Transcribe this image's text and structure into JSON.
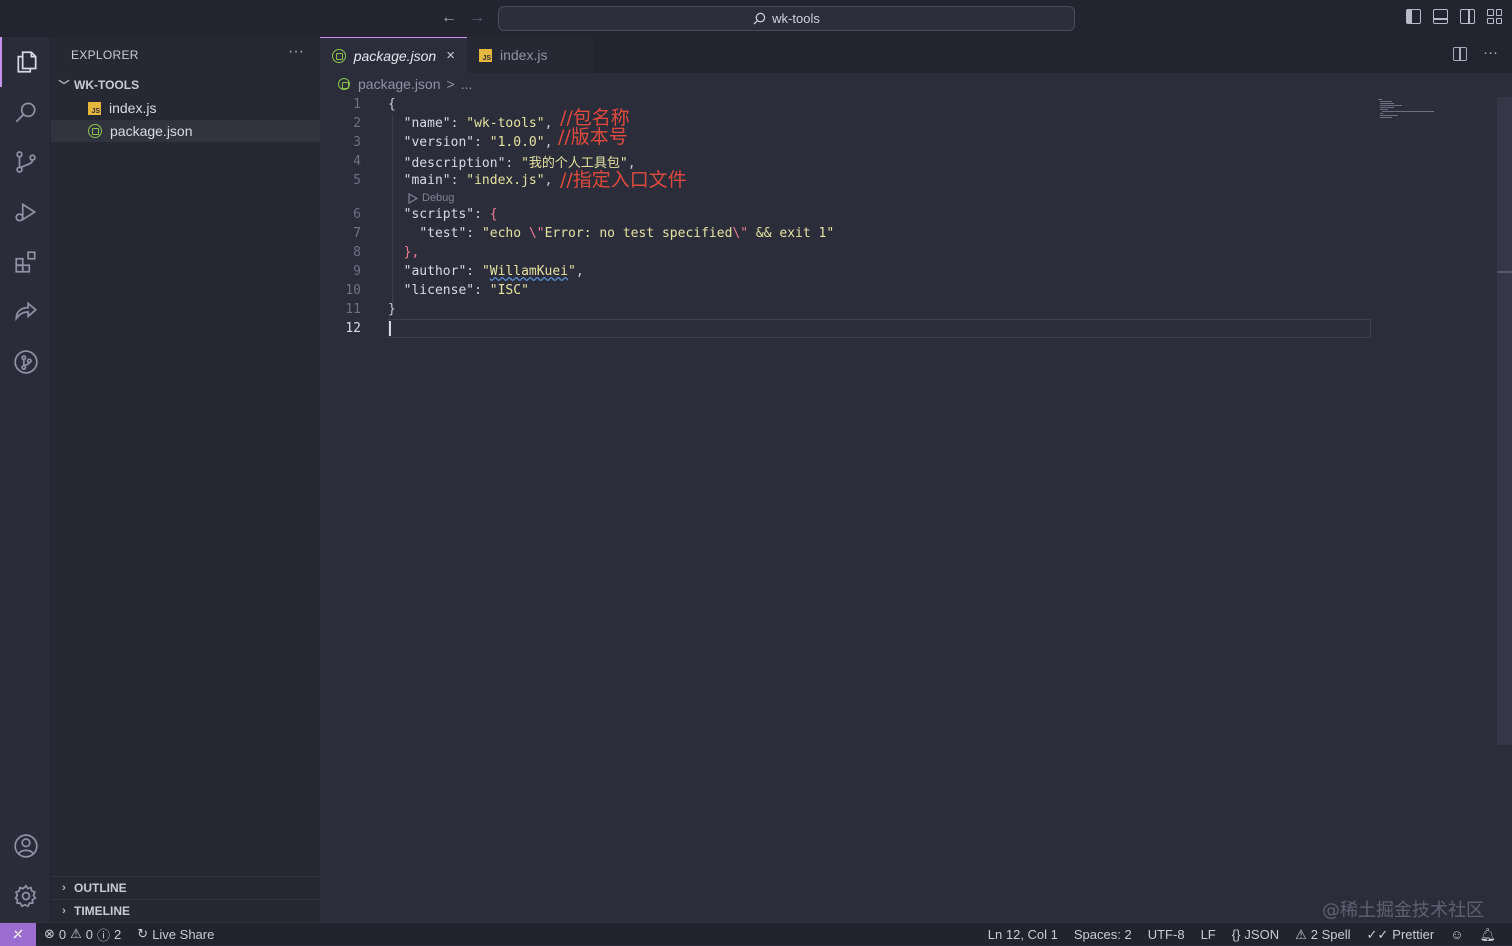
{
  "titlebar": {
    "search_text": "wk-tools",
    "back": "←",
    "forward": "→"
  },
  "sidebar": {
    "title": "EXPLORER",
    "more": "···",
    "folder": "WK-TOOLS",
    "files": [
      {
        "name": "index.js",
        "type": "js"
      },
      {
        "name": "package.json",
        "type": "json"
      }
    ],
    "outline": "OUTLINE",
    "timeline": "TIMELINE"
  },
  "tabs": [
    {
      "label": "package.json",
      "active": true
    },
    {
      "label": "index.js",
      "active": false
    }
  ],
  "tab_close": "×",
  "tab_more": "···",
  "breadcrumb": {
    "file": "package.json",
    "sep": ">",
    "rest": "..."
  },
  "code": {
    "line_numbers": [
      "1",
      "2",
      "3",
      "4",
      "5",
      "6",
      "7",
      "8",
      "9",
      "10",
      "11",
      "12"
    ],
    "codelens": "Debug",
    "lines": {
      "l1": "{",
      "l2_key": "\"name\"",
      "l2_val": "\"wk-tools\"",
      "l3_key": "\"version\"",
      "l3_val": "\"1.0.0\"",
      "l4_key": "\"description\"",
      "l4_val": "\"我的个人工具包\"",
      "l5_key": "\"main\"",
      "l5_val": "\"index.js\"",
      "l6_key": "\"scripts\"",
      "l6_brace": "{",
      "l7_key": "\"test\"",
      "l7_val_a": "\"echo ",
      "l7_esc1": "\\\"",
      "l7_val_b": "Error: no test specified",
      "l7_esc2": "\\\"",
      "l7_val_c": " && exit 1\"",
      "l8": "},",
      "l9_key": "\"author\"",
      "l9_val_q1": "\"",
      "l9_val": "WillamKuei",
      "l9_val_q2": "\"",
      "l10_key": "\"license\"",
      "l10_val": "\"ISC\"",
      "l11": "}"
    },
    "annotations": {
      "a1": "//包名称",
      "a2": "//版本号",
      "a3": "//指定入口文件"
    }
  },
  "watermark": "@稀土掘金技术社区",
  "status": {
    "errors": "0",
    "warnings": "0",
    "info": "2",
    "live_share": "Live Share",
    "position": "Ln 12, Col 1",
    "spaces": "Spaces: 2",
    "encoding": "UTF-8",
    "eol": "LF",
    "language": "JSON",
    "spell": "2 Spell",
    "prettier": "Prettier"
  },
  "colors": {
    "accent": "#c792ea",
    "string": "#e6e3a0",
    "annotation": "#e04a3c",
    "remote": "#9b6dd0"
  }
}
